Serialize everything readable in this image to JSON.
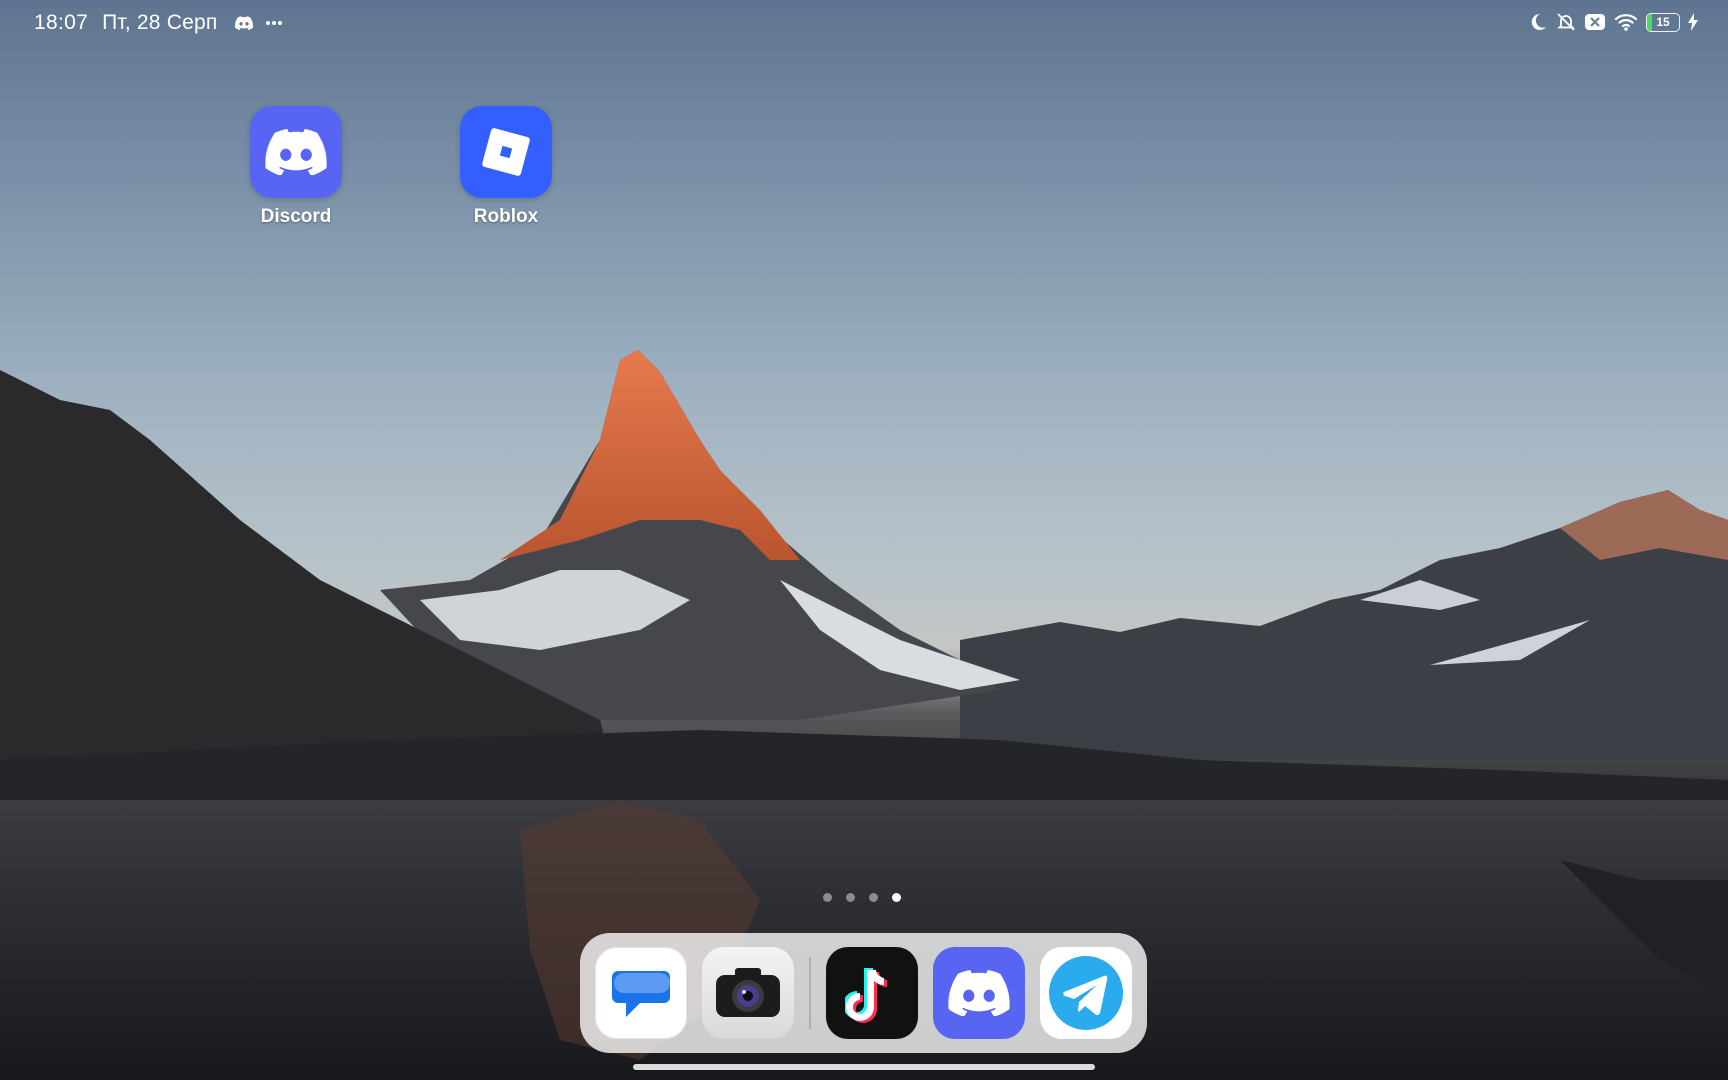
{
  "status_bar": {
    "time": "18:07",
    "date": "Пт, 28 Серп",
    "notification_icons": [
      "discord-icon",
      "more-icon"
    ],
    "system_icons": [
      "moon-icon",
      "silent-bell-icon",
      "sim-off-icon",
      "wifi-icon"
    ],
    "battery_level": "15",
    "battery_fraction": 0.15,
    "charging": true
  },
  "home": {
    "apps": [
      {
        "label": "Discord",
        "icon": "discord-icon",
        "color": "#5865f2"
      },
      {
        "label": "Roblox",
        "icon": "roblox-icon",
        "color": "#335fff"
      }
    ],
    "page_indicator": {
      "pages": 4,
      "active_index": 3
    }
  },
  "dock": {
    "apps": [
      {
        "name": "Messages",
        "icon": "messages-icon",
        "color": "#ffffff"
      },
      {
        "name": "Camera",
        "icon": "camera-icon",
        "color": "#e9e9e9"
      },
      {
        "name": "TikTok",
        "icon": "tiktok-icon",
        "color": "#111111"
      },
      {
        "name": "Discord",
        "icon": "discord-icon",
        "color": "#5865f2"
      },
      {
        "name": "Telegram",
        "icon": "telegram-icon",
        "color": "#ffffff"
      }
    ]
  }
}
